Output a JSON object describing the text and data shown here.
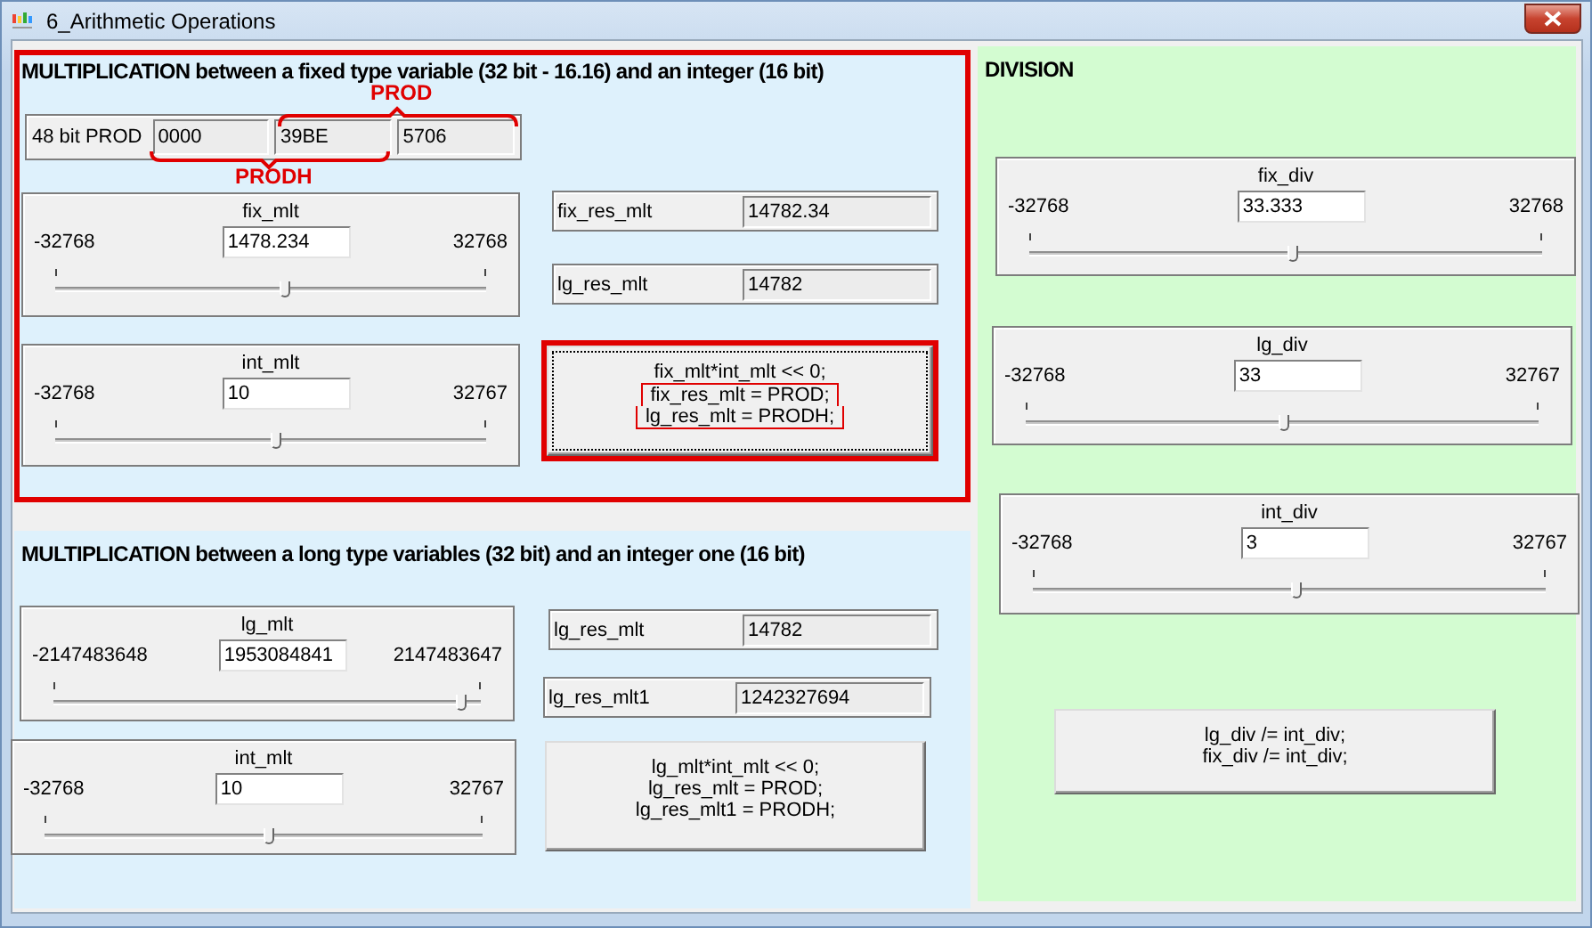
{
  "window": {
    "title": "6_Arithmetic Operations"
  },
  "fixed_multiplication": {
    "title": "MULTIPLICATION between a fixed type variable (32 bit - 16.16) and an integer (16 bit)",
    "highlighted": true,
    "prod": {
      "label": "48 bit PROD",
      "fields": [
        "0000",
        "39BE",
        "5706"
      ],
      "prod_label": "PROD",
      "prodh_label": "PRODH"
    },
    "sliders": [
      {
        "label": "fix_mlt",
        "min": "-32768",
        "value": "1478.234",
        "max": "32768",
        "level": 0.53
      },
      {
        "label": "int_mlt",
        "min": "-32768",
        "value": "10",
        "max": "32767",
        "level": 0.51
      }
    ],
    "results": [
      {
        "label": "fix_res_mlt",
        "value": "14782.34"
      },
      {
        "label": "lg_res_mlt",
        "value": "14782"
      }
    ],
    "button": {
      "focused": true,
      "highlighted": true,
      "lines": [
        {
          "text": "fix_mlt*int_mlt << 0;",
          "boxed": false
        },
        {
          "text": "fix_res_mlt = PROD;",
          "boxed": true
        },
        {
          "text": "lg_res_mlt = PRODH;",
          "boxed": true
        }
      ]
    }
  },
  "long_multiplication": {
    "title": "MULTIPLICATION between a long type variables (32 bit) and an integer one (16 bit)",
    "highlighted": false,
    "sliders": [
      {
        "label": "lg_mlt",
        "min": "-2147483648",
        "value": "1953084841",
        "max": "2147483647",
        "level": 0.95
      },
      {
        "label": "int_mlt",
        "min": "-32768",
        "value": "10",
        "max": "32767",
        "level": 0.51
      }
    ],
    "results": [
      {
        "label": "lg_res_mlt",
        "value": "14782"
      },
      {
        "label": "lg_res_mlt1",
        "value": "1242327694"
      }
    ],
    "button": {
      "focused": false,
      "highlighted": false,
      "lines": [
        {
          "text": "lg_mlt*int_mlt << 0;",
          "boxed": false
        },
        {
          "text": "lg_res_mlt = PROD;",
          "boxed": false
        },
        {
          "text": "lg_res_mlt1 = PRODH;",
          "boxed": false
        }
      ]
    }
  },
  "division": {
    "title": "DIVISION",
    "sliders": [
      {
        "label": "fix_div",
        "min": "-32768",
        "value": "33.333",
        "max": "32768",
        "level": 0.51
      },
      {
        "label": "lg_div",
        "min": "-32768",
        "value": "33",
        "max": "32767",
        "level": 0.5
      },
      {
        "label": "int_div",
        "min": "-32768",
        "value": "3",
        "max": "32767",
        "level": 0.51
      }
    ],
    "button": {
      "focused": false,
      "highlighted": false,
      "lines": [
        {
          "text": "lg_div /= int_div;",
          "boxed": false
        },
        {
          "text": "fix_div /= int_div;",
          "boxed": false
        }
      ]
    }
  }
}
